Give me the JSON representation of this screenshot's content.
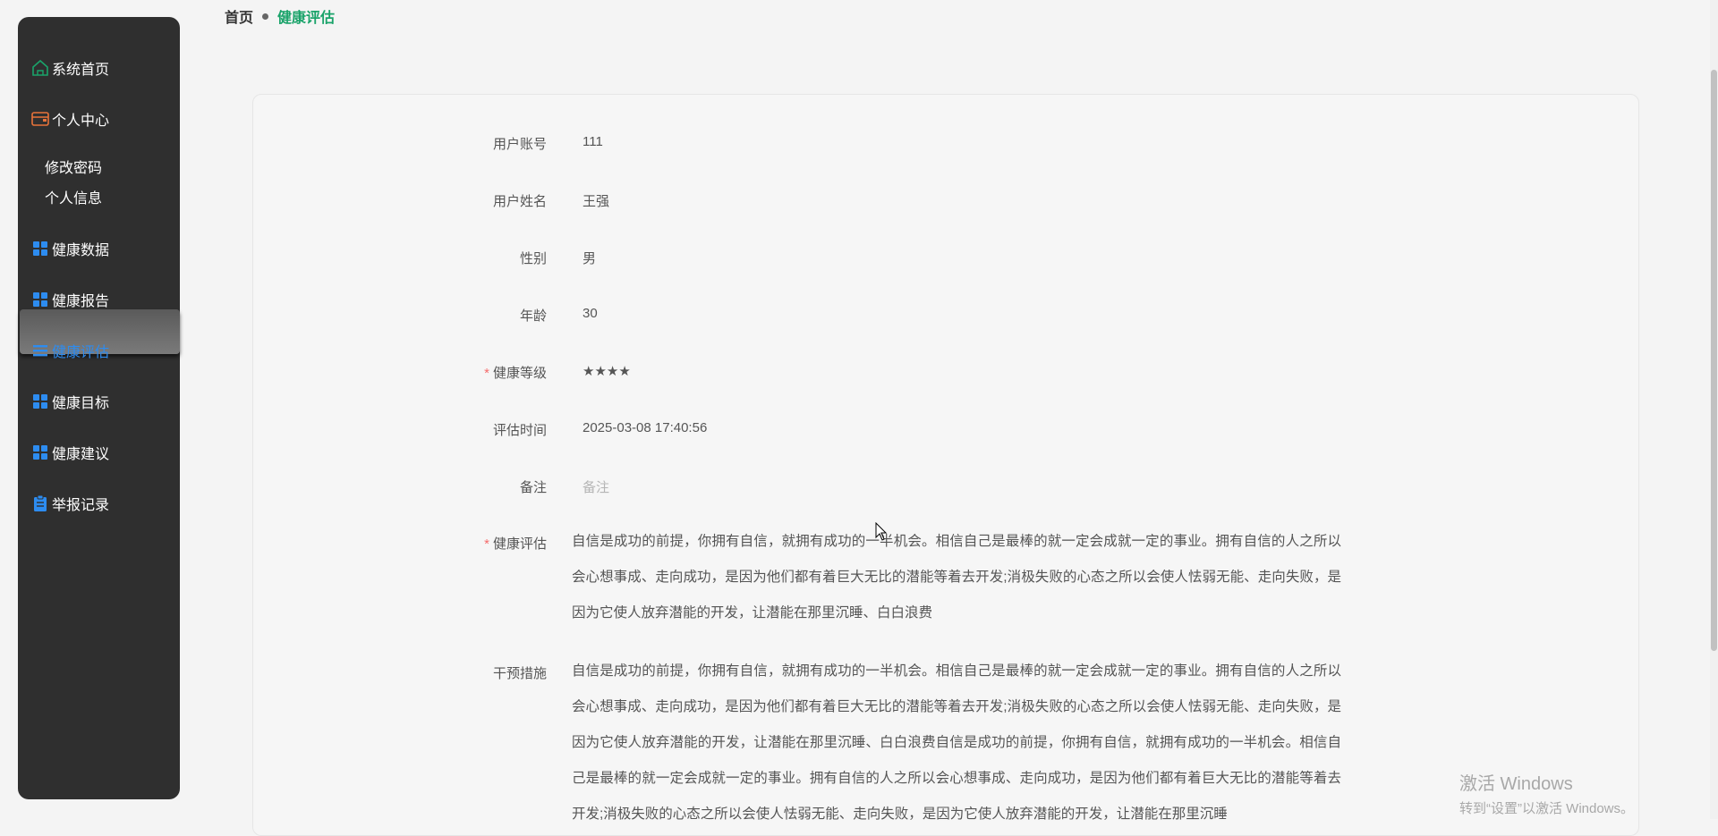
{
  "sidebar": {
    "items": [
      {
        "label": "系统首页",
        "icon": "home-icon"
      },
      {
        "label": "个人中心",
        "icon": "wallet-icon"
      },
      {
        "label": "健康数据",
        "icon": "grid-icon"
      },
      {
        "label": "健康报告",
        "icon": "grid-icon"
      },
      {
        "label": "健康评估",
        "icon": "list-icon"
      },
      {
        "label": "健康目标",
        "icon": "grid-icon"
      },
      {
        "label": "健康建议",
        "icon": "grid-icon"
      },
      {
        "label": "举报记录",
        "icon": "clipboard-icon"
      }
    ],
    "sub_items": [
      "修改密码",
      "个人信息"
    ],
    "active": "健康评估"
  },
  "breadcrumb": {
    "home": "首页",
    "current": "健康评估"
  },
  "form": {
    "account_label": "用户账号",
    "account_value": "111",
    "name_label": "用户姓名",
    "name_value": "王强",
    "gender_label": "性别",
    "gender_value": "男",
    "age_label": "年龄",
    "age_value": "30",
    "level_label": "健康等级",
    "level_value": "★★★★",
    "time_label": "评估时间",
    "time_value": "2025-03-08 17:40:56",
    "remark_label": "备注",
    "remark_placeholder": "备注",
    "eval_label": "健康评估",
    "eval_value": "自信是成功的前提，你拥有自信，就拥有成功的一半机会。相信自己是最棒的就一定会成就一定的事业。拥有自信的人之所以会心想事成、走向成功，是因为他们都有着巨大无比的潜能等着去开发;消极失败的心态之所以会使人怯弱无能、走向失败，是因为它使人放弃潜能的开发，让潜能在那里沉睡、白白浪费",
    "intervention_label": "干预措施",
    "intervention_value": "自信是成功的前提，你拥有自信，就拥有成功的一半机会。相信自己是最棒的就一定会成就一定的事业。拥有自信的人之所以会心想事成、走向成功，是因为他们都有着巨大无比的潜能等着去开发;消极失败的心态之所以会使人怯弱无能、走向失败，是因为它使人放弃潜能的开发，让潜能在那里沉睡、白白浪费自信是成功的前提，你拥有自信，就拥有成功的一半机会。相信自己是最棒的就一定会成就一定的事业。拥有自信的人之所以会心想事成、走向成功，是因为他们都有着巨大无比的潜能等着去开发;消极失败的心态之所以会使人怯弱无能、走向失败，是因为它使人放弃潜能的开发，让潜能在那里沉睡"
  },
  "watermark": {
    "line1": "激活 Windows",
    "line2": "转到“设置”以激活 Windows。"
  },
  "colors": {
    "accent": "#2d8cf0",
    "breadcrumb_current": "#1aa36a",
    "sidebar_bg": "#2f2f2f",
    "required": "#f56c6c"
  }
}
